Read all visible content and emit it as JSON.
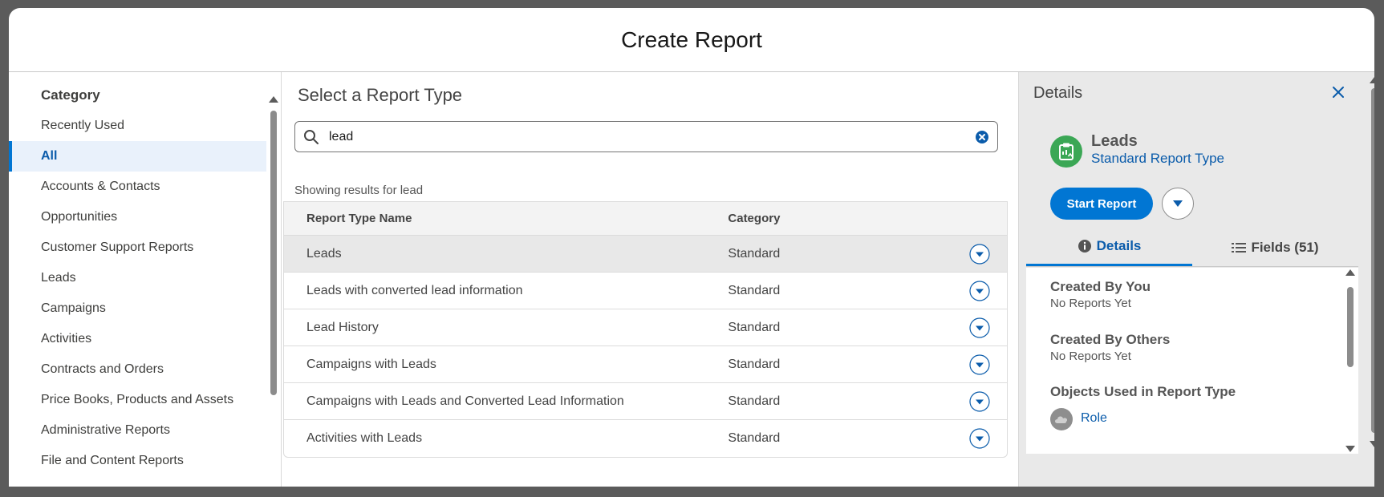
{
  "modal": {
    "title": "Create Report"
  },
  "categories": {
    "heading": "Category",
    "items": [
      {
        "label": "Recently Used",
        "active": false
      },
      {
        "label": "All",
        "active": true
      },
      {
        "label": "Accounts & Contacts",
        "active": false
      },
      {
        "label": "Opportunities",
        "active": false
      },
      {
        "label": "Customer Support Reports",
        "active": false
      },
      {
        "label": "Leads",
        "active": false
      },
      {
        "label": "Campaigns",
        "active": false
      },
      {
        "label": "Activities",
        "active": false
      },
      {
        "label": "Contracts and Orders",
        "active": false
      },
      {
        "label": "Price Books, Products and Assets",
        "active": false
      },
      {
        "label": "Administrative Reports",
        "active": false
      },
      {
        "label": "File and Content Reports",
        "active": false
      }
    ]
  },
  "center": {
    "title": "Select a Report Type",
    "search_value": "lead",
    "results_note": "Showing results for lead",
    "columns": {
      "name": "Report Type Name",
      "category": "Category"
    },
    "rows": [
      {
        "name": "Leads",
        "category": "Standard",
        "selected": true
      },
      {
        "name": "Leads with converted lead information",
        "category": "Standard",
        "selected": false
      },
      {
        "name": "Lead History",
        "category": "Standard",
        "selected": false
      },
      {
        "name": "Campaigns with Leads",
        "category": "Standard",
        "selected": false
      },
      {
        "name": "Campaigns with Leads and Converted Lead Information",
        "category": "Standard",
        "selected": false
      },
      {
        "name": "Activities with Leads",
        "category": "Standard",
        "selected": false
      }
    ]
  },
  "details": {
    "title": "Details",
    "report_type_name": "Leads",
    "report_type_kind": "Standard Report Type",
    "start_label": "Start Report",
    "tabs": [
      {
        "label": "Details",
        "icon": "info-icon",
        "active": true
      },
      {
        "label": "Fields (51)",
        "icon": "list-icon",
        "active": false
      }
    ],
    "created_by_you": {
      "title": "Created By You",
      "value": "No Reports Yet"
    },
    "created_by_others": {
      "title": "Created By Others",
      "value": "No Reports Yet"
    },
    "objects": {
      "title": "Objects Used in Report Type",
      "items": [
        "Role"
      ]
    }
  },
  "colors": {
    "brand": "#0176d3",
    "link": "#0b5cab",
    "report_icon_bg": "#3ba755",
    "overlay": "#5b5b5b"
  }
}
